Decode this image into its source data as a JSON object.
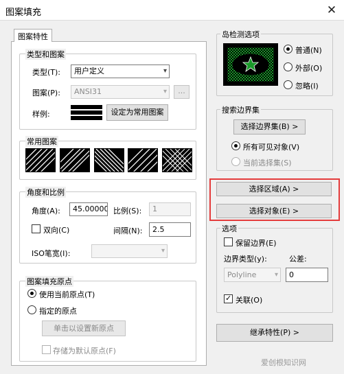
{
  "window": {
    "title": "图案填充"
  },
  "tabs": [
    {
      "label": "图案特性"
    }
  ],
  "type_pattern": {
    "legend": "类型和图案",
    "type_label": "类型(T):",
    "type_value": "用户定义",
    "pattern_label": "图案(P):",
    "pattern_value": "ANSI31",
    "pattern_browse": "...",
    "sample_label": "样例:",
    "set_common_button": "设定为常用图案"
  },
  "common_patterns": {
    "legend": "常用图案",
    "count": 5
  },
  "angle_scale": {
    "legend": "角度和比例",
    "angle_label": "角度(A):",
    "angle_value": "45.000000",
    "scale_label": "比例(S):",
    "scale_value": "1",
    "double_label": "双向(C)",
    "spacing_label": "间隔(N):",
    "spacing_value": "2.5",
    "iso_label": "ISO笔宽(I):",
    "iso_value": ""
  },
  "origin": {
    "legend": "图案填充原点",
    "use_current_label": "使用当前原点(T)",
    "specified_label": "指定的原点",
    "set_origin_button": "单击以设置新原点",
    "store_default_label": "存储为默认原点(F)"
  },
  "island": {
    "legend": "岛检测选项",
    "normal_label": "普通(N)",
    "outer_label": "外部(O)",
    "ignore_label": "忽略(I)"
  },
  "boundary_set": {
    "legend": "搜索边界集",
    "select_button": "选择边界集(B) >",
    "all_visible_label": "所有可见对象(V)",
    "current_set_label": "当前选择集(S)"
  },
  "actions": {
    "select_area_button": "选择区域(A) >",
    "select_objects_button": "选择对象(E) >"
  },
  "options": {
    "legend": "选项",
    "keep_boundary_label": "保留边界(E)",
    "boundary_type_label": "边界类型(y):",
    "boundary_type_value": "Polyline",
    "tolerance_label": "公差:",
    "tolerance_value": "0",
    "associative_label": "关联(O)"
  },
  "inherit_button": "继承特性(P) >",
  "watermark": "爱创根知识网",
  "colors": {
    "accent_red": "#e43b3b",
    "preview_green": "#1a9a2a"
  }
}
